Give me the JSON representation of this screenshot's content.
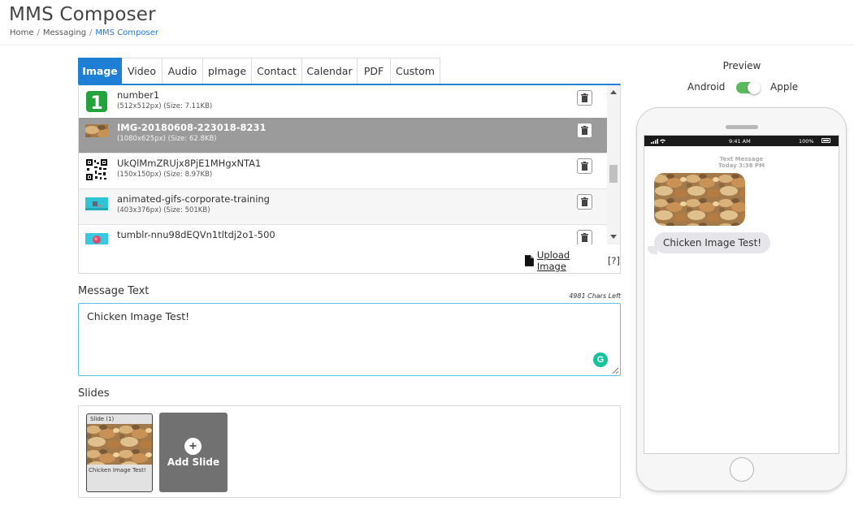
{
  "header": {
    "title": "MMS Composer",
    "breadcrumb": [
      "Home",
      "Messaging",
      "MMS Composer"
    ]
  },
  "tabs": [
    {
      "label": "Image",
      "active": true
    },
    {
      "label": "Video",
      "active": false
    },
    {
      "label": "Audio",
      "active": false
    },
    {
      "label": "pImage",
      "active": false
    },
    {
      "label": "Contact",
      "active": false
    },
    {
      "label": "Calendar",
      "active": false
    },
    {
      "label": "PDF",
      "active": false
    },
    {
      "label": "Custom",
      "active": false
    }
  ],
  "media_list": [
    {
      "name": "number1",
      "meta": "(512x512px) (Size: 7.11KB)",
      "icon": "number-one-image",
      "selected": false
    },
    {
      "name": "IMG-20180608-223018-8231",
      "meta": "(1080x625px) (Size: 62.8KB)",
      "icon": "chicken-photo",
      "selected": true
    },
    {
      "name": "UkQlMmZRUjx8PjE1MHgxNTA1",
      "meta": "(150x150px) (Size: 8.97KB)",
      "icon": "qr-code-image",
      "selected": false
    },
    {
      "name": "animated-gifs-corporate-training",
      "meta": "(403x376px) (Size: 501KB)",
      "icon": "animated-gif-thumb",
      "selected": false
    },
    {
      "name": "tumblr-nnu98dEQVn1tltdj2o1-500",
      "meta": "",
      "icon": "tumblr-gif-thumb",
      "selected": false
    }
  ],
  "upload": {
    "label": "Upload Image",
    "help": "[?]"
  },
  "message": {
    "label": "Message Text",
    "chars_left": "4981 Chars Left",
    "value": "Chicken Image Test!"
  },
  "slides": {
    "label": "Slides",
    "items": [
      {
        "title": "Slide (1)",
        "caption": "Chicken Image Test!"
      }
    ],
    "add_label": "Add Slide",
    "add_icon": "+"
  },
  "preview": {
    "title": "Preview",
    "android_label": "Android",
    "apple_label": "Apple",
    "apple_selected": true,
    "status_time": "9:41 AM",
    "status_battery": "100%",
    "message_header_line1": "Text Message",
    "message_header_line2": "Today 3:38 PM",
    "bubble_text": "Chicken Image Test!"
  },
  "colors": {
    "accent": "#1e7fd4",
    "selected_row": "#9b9b9b",
    "toggle_on": "#5cb85c",
    "grammarly": "#15c39a",
    "add_slide_bg": "#717171"
  }
}
